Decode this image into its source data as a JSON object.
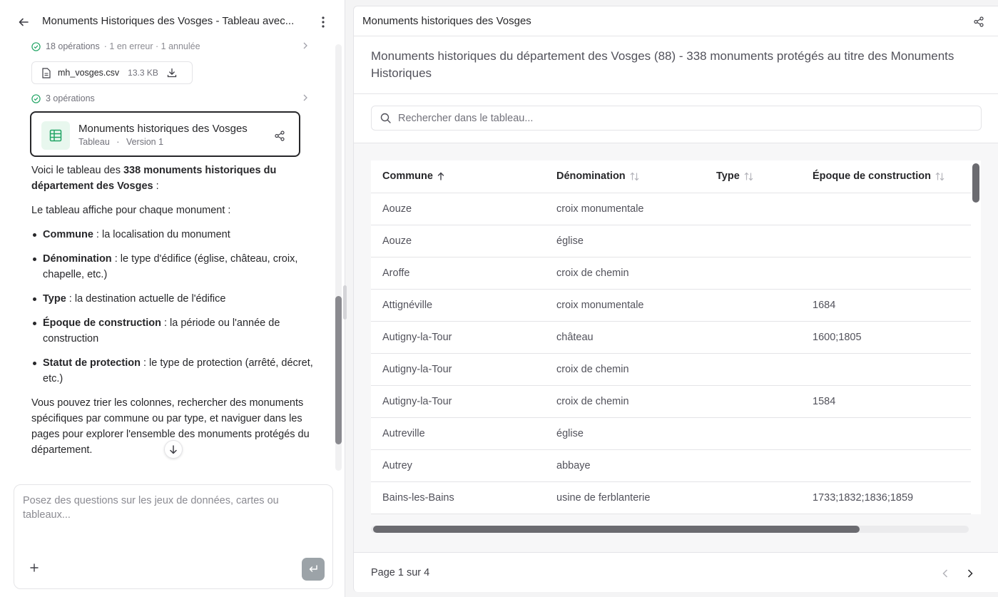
{
  "chat": {
    "title": "Monuments Historiques des Vosges - Tableau avec...",
    "ops1": {
      "count": "18 opérations",
      "extra": "· 1 en erreur · 1 annulée"
    },
    "file": {
      "name": "mh_vosges.csv",
      "size": "13.3 KB"
    },
    "ops2": {
      "count": "3 opérations"
    },
    "artifact": {
      "title": "Monuments historiques des Vosges",
      "kind": "Tableau",
      "version": "Version 1",
      "separator": "·"
    },
    "message": {
      "intro_prefix": "Voici le tableau des ",
      "intro_bold": "338 monuments historiques du département des Vosges",
      "intro_suffix": " :",
      "line2": "Le tableau affiche pour chaque monument :",
      "bullets": [
        {
          "term": "Commune",
          "desc": " : la localisation du monument"
        },
        {
          "term": "Dénomination",
          "desc": " : le type d'édifice (église, château, croix, chapelle, etc.)"
        },
        {
          "term": "Type",
          "desc": " : la destination actuelle de l'édifice"
        },
        {
          "term": "Époque de construction",
          "desc": " : la période ou l'année de construction"
        },
        {
          "term": "Statut de protection",
          "desc": " : le type de protection (arrêté, décret, etc.)"
        }
      ],
      "outro": "Vous pouvez trier les colonnes, rechercher des monuments spécifiques par commune ou par type, et naviguer dans les pages pour explorer l'ensemble des monuments protégés du département."
    },
    "composer": {
      "placeholder": "Posez des questions sur les jeux de données, cartes ou tableaux..."
    }
  },
  "panel": {
    "title": "Monuments historiques des Vosges",
    "description": "Monuments historiques du département des Vosges (88) - 338 monuments protégés au titre des Monuments Historiques",
    "search_placeholder": "Rechercher dans le tableau...",
    "columns": [
      "Commune",
      "Dénomination",
      "Type",
      "Époque de construction"
    ],
    "rows": [
      [
        "Aouze",
        "croix monumentale",
        "",
        ""
      ],
      [
        "Aouze",
        "église",
        "",
        ""
      ],
      [
        "Aroffe",
        "croix de chemin",
        "",
        ""
      ],
      [
        "Attignéville",
        "croix monumentale",
        "",
        "1684"
      ],
      [
        "Autigny-la-Tour",
        "château",
        "",
        "1600;1805"
      ],
      [
        "Autigny-la-Tour",
        "croix de chemin",
        "",
        ""
      ],
      [
        "Autigny-la-Tour",
        "croix de chemin",
        "",
        "1584"
      ],
      [
        "Autreville",
        "église",
        "",
        ""
      ],
      [
        "Autrey",
        "abbaye",
        "",
        ""
      ],
      [
        "Bains-les-Bains",
        "usine de ferblanterie",
        "",
        "1733;1832;1836;1859"
      ]
    ],
    "pagination": "Page 1 sur 4"
  },
  "colors": {
    "accent_green": "#22a565",
    "border": "#e4e4e7",
    "text": "#27272a",
    "muted": "#71717a"
  }
}
